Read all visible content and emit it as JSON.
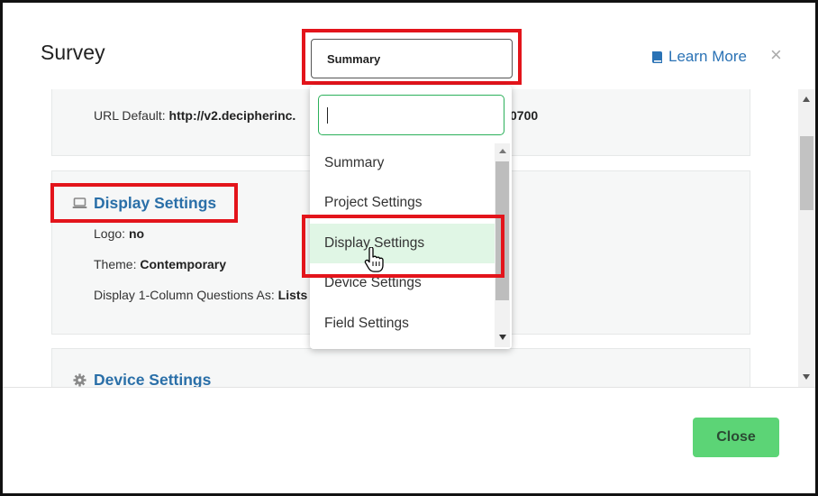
{
  "modal": {
    "title": "Survey",
    "learn_more": "Learn More",
    "close_x": "×",
    "close_button": "Close"
  },
  "select": {
    "value": "Summary",
    "search_value": "",
    "options": [
      "Summary",
      "Project Settings",
      "Display Settings",
      "Device Settings",
      "Field Settings"
    ],
    "highlighted": "Display Settings"
  },
  "sections": {
    "url": {
      "label": "URL Default: ",
      "value_left": "http://v2.decipherinc.",
      "value_right": "0700"
    },
    "display": {
      "title": "Display Settings",
      "logo_label": "Logo: ",
      "logo_value": "no",
      "theme_label": "Theme: ",
      "theme_value": "Contemporary",
      "onecol_label": "Display 1-Column Questions As: ",
      "onecol_value": "Lists"
    },
    "device": {
      "title": "Device Settings"
    }
  },
  "colors": {
    "accent_blue": "#2a6fa8",
    "link_blue": "#2a72b5",
    "close_green": "#5cd476",
    "highlight_green": "#e0f6e5",
    "annotation_red": "#e3141b"
  },
  "icons": {
    "learn_more": "book-icon",
    "display": "laptop-icon",
    "device": "gear-icon"
  }
}
